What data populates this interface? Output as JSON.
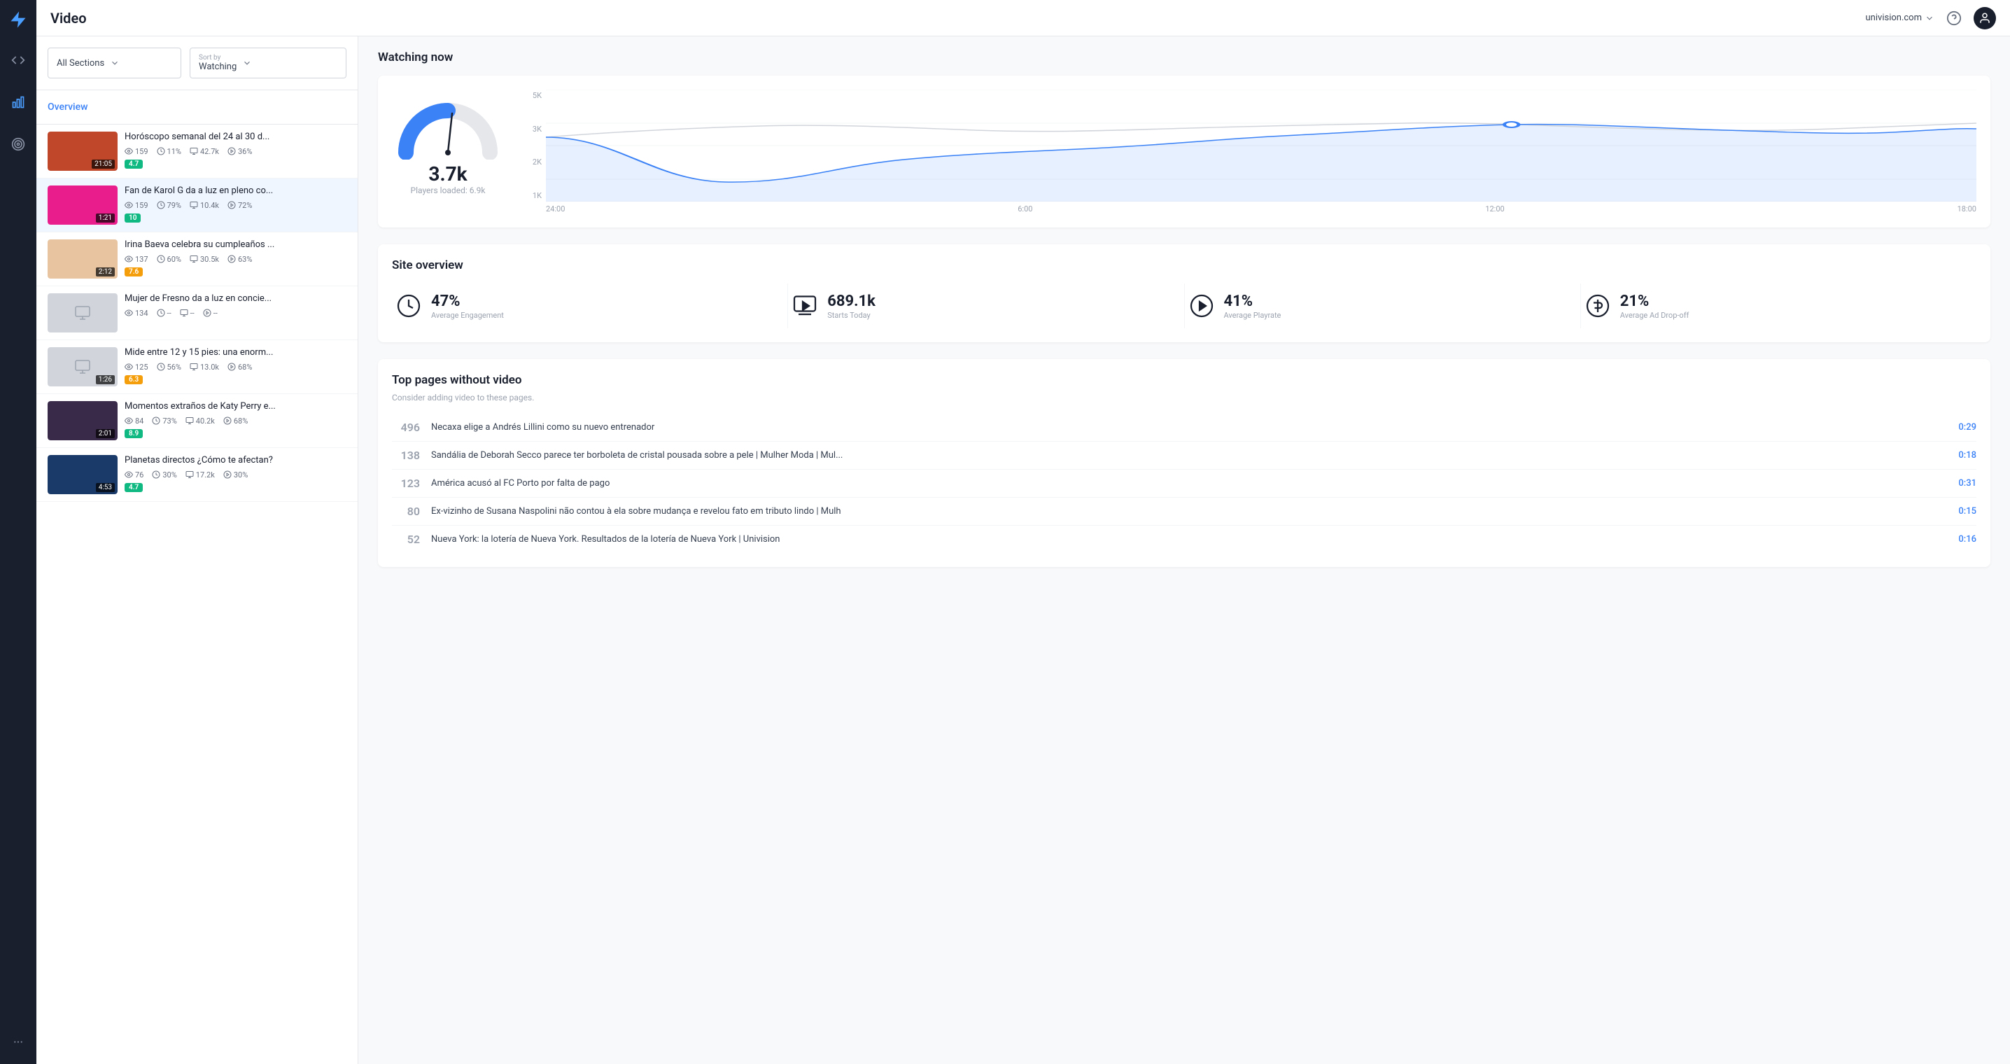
{
  "app": {
    "title": "Video",
    "domain": "univision.com"
  },
  "sidebar": {
    "icons": [
      {
        "name": "logo-icon",
        "label": "Logo"
      },
      {
        "name": "lightning-icon",
        "label": "Lightning"
      },
      {
        "name": "bar-chart-icon",
        "label": "Analytics"
      },
      {
        "name": "target-icon",
        "label": "Target"
      },
      {
        "name": "more-icon",
        "label": "More"
      }
    ]
  },
  "filters": {
    "section_label": "All Sections",
    "sort_by_label": "Sort by",
    "sort_by_value": "Watching"
  },
  "overview": {
    "label": "Overview"
  },
  "videos": [
    {
      "title": "Horóscopo semanal del 24 al 30 d...",
      "duration": "21:05",
      "watching": "159",
      "engagement": "11%",
      "starts": "42.7k",
      "playrate": "36%",
      "score": "4.7",
      "score_color": "green",
      "has_thumb": true,
      "thumb_color": "#c0472a"
    },
    {
      "title": "Fan de Karol G da a luz en pleno co...",
      "duration": "1:21",
      "watching": "159",
      "engagement": "79%",
      "starts": "10.4k",
      "playrate": "72%",
      "score": "10",
      "score_color": "green",
      "has_thumb": true,
      "thumb_color": "#e91e8c"
    },
    {
      "title": "Irina Baeva celebra su cumpleaños ...",
      "duration": "2:12",
      "watching": "137",
      "engagement": "60%",
      "starts": "30.5k",
      "playrate": "63%",
      "score": "7.6",
      "score_color": "yellow",
      "has_thumb": true,
      "thumb_color": "#e8c4a0"
    },
    {
      "title": "Mujer de Fresno da a luz en concie...",
      "duration": "",
      "watching": "134",
      "engagement": "--",
      "starts": "--",
      "playrate": "--",
      "score": "",
      "score_color": "",
      "has_thumb": false,
      "thumb_color": "#d1d5db"
    },
    {
      "title": "Mide entre 12 y 15 pies: una enorm...",
      "duration": "1:26",
      "watching": "125",
      "engagement": "56%",
      "starts": "13.0k",
      "playrate": "68%",
      "score": "6.3",
      "score_color": "yellow",
      "has_thumb": false,
      "thumb_color": "#d1d5db"
    },
    {
      "title": "Momentos extraños de Katy Perry e...",
      "duration": "2:01",
      "watching": "84",
      "engagement": "73%",
      "starts": "40.2k",
      "playrate": "68%",
      "score": "8.9",
      "score_color": "green",
      "has_thumb": true,
      "thumb_color": "#3a2a4a"
    },
    {
      "title": "Planetas directos ¿Cómo te afectan?",
      "duration": "4:53",
      "watching": "76",
      "engagement": "30%",
      "starts": "17.2k",
      "playrate": "30%",
      "score": "4.7",
      "score_color": "green",
      "has_thumb": true,
      "thumb_color": "#1a3a6a"
    }
  ],
  "watching_now": {
    "section_title": "Watching now",
    "gauge_value": "3.7k",
    "players_loaded_label": "Players loaded:",
    "players_loaded_value": "6.9k",
    "chart_y_labels": [
      "5K",
      "3K",
      "2K",
      "1K"
    ],
    "chart_x_labels": [
      "24:00",
      "6:00",
      "12:00",
      "18:00"
    ]
  },
  "site_overview": {
    "section_title": "Site overview",
    "metrics": [
      {
        "value": "47%",
        "label": "Average Engagement",
        "icon": "clock-icon"
      },
      {
        "value": "689.1k",
        "label": "Starts Today",
        "icon": "forward-icon"
      },
      {
        "value": "41%",
        "label": "Average Playrate",
        "icon": "play-icon"
      },
      {
        "value": "21%",
        "label": "Average Ad Drop-off",
        "icon": "dollar-icon"
      }
    ]
  },
  "top_pages": {
    "section_title": "Top pages without video",
    "subtitle": "Consider adding video to these pages.",
    "pages": [
      {
        "count": "496",
        "title": "Necaxa elige a Andrés Lillini como su nuevo entrenador",
        "time": "0:29"
      },
      {
        "count": "138",
        "title": "Sandália de Deborah Secco parece ter borboleta de cristal pousada sobre a pele | Mulher Moda | Mul...",
        "time": "0:18"
      },
      {
        "count": "123",
        "title": "América acusó al FC Porto por falta de pago",
        "time": "0:31"
      },
      {
        "count": "80",
        "title": "Ex-vizinho de Susana Naspolini não contou à ela sobre mudança e revelou fato em tributo lindo | Mulh",
        "time": "0:15"
      },
      {
        "count": "52",
        "title": "Nueva York: la lotería de Nueva York. Resultados de la lotería de Nueva York | Univision",
        "time": "0:16"
      }
    ]
  }
}
